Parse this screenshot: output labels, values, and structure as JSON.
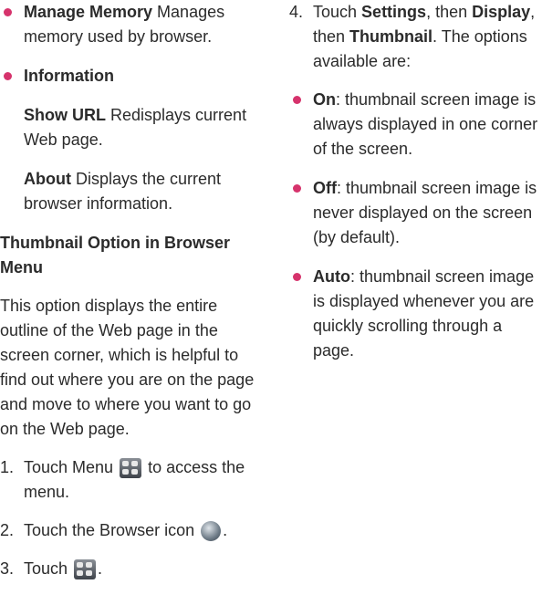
{
  "left": {
    "manage_memory": {
      "term": "Manage Memory",
      "desc": " Manages memory used by browser."
    },
    "information": {
      "term": "Information"
    },
    "show_url": {
      "term": "Show URL",
      "desc": " Redisplays current Web page."
    },
    "about": {
      "term": "About",
      "desc": " Displays the current browser information."
    },
    "heading": "Thumbnail Option in Browser Menu",
    "paragraph": "This option displays the entire outline of the Web page in the screen corner, which is helpful to find out where you are on the page and move to where you want to go on the Web page.",
    "step1": {
      "num": "1.",
      "a": "Touch Menu ",
      "b": " to access the menu."
    },
    "step2": {
      "num": "2.",
      "a": "Touch the Browser icon ",
      "b": "."
    },
    "step3": {
      "num": "3.",
      "a": "Touch ",
      "b": "."
    }
  },
  "right": {
    "step4": {
      "num": "4.",
      "a": "Touch ",
      "settings": "Settings",
      "b": ", then ",
      "display": "Display",
      "c": ", then ",
      "thumbnail": "Thumbnail",
      "d": ". The options available are:"
    },
    "on": {
      "term": "On",
      "desc": ": thumbnail screen image is always displayed in one corner of the screen."
    },
    "off": {
      "term": "Off",
      "desc": ": thumbnail screen image is never displayed on the screen (by default)."
    },
    "auto": {
      "term": "Auto",
      "desc": ": thumbnail screen image is displayed whenever you are quickly scrolling through a page."
    }
  },
  "colors": {
    "bullet": "#d6336c",
    "text": "#2b2b2b"
  },
  "icons": [
    "menu-icon",
    "browser-icon"
  ]
}
